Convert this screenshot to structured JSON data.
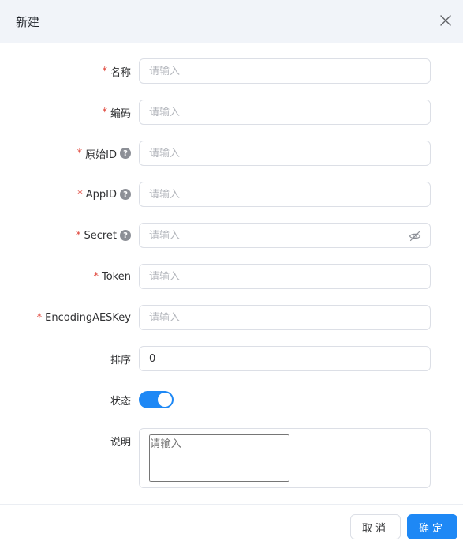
{
  "dialog": {
    "title": "新建"
  },
  "fields": {
    "name": {
      "label": "名称",
      "required": "*",
      "placeholder": "请输入",
      "value": ""
    },
    "code": {
      "label": "编码",
      "required": "*",
      "placeholder": "请输入",
      "value": ""
    },
    "original_id": {
      "label": "原始ID",
      "required": "*",
      "placeholder": "请输入",
      "help": "?"
    },
    "app_id": {
      "label": "AppID",
      "required": "*",
      "placeholder": "请输入",
      "help": "?"
    },
    "secret": {
      "label": "Secret",
      "required": "*",
      "placeholder": "请输入",
      "help": "?"
    },
    "token": {
      "label": "Token",
      "required": "*",
      "placeholder": "请输入"
    },
    "encoding_aes_key": {
      "label": "EncodingAESKey",
      "required": "*",
      "placeholder": "请输入"
    },
    "sort": {
      "label": "排序",
      "value": "0"
    },
    "status": {
      "label": "状态",
      "enabled": true
    },
    "description": {
      "label": "说明",
      "placeholder": "请输入"
    }
  },
  "footer": {
    "cancel_label": "取消",
    "ok_label": "确定"
  },
  "colors": {
    "primary": "#1e88f5",
    "required": "#e0453a",
    "header_bg": "#f1f4f9"
  }
}
